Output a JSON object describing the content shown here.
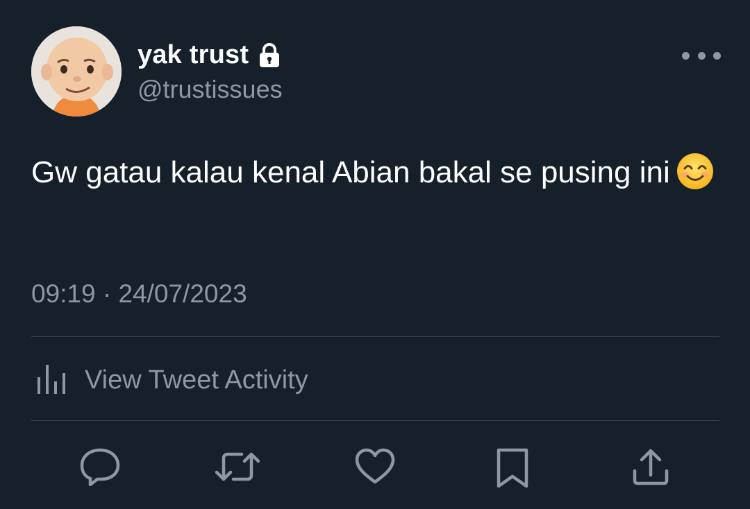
{
  "tweet": {
    "display_name": "yak trust",
    "handle": "@trustissues",
    "text": "Gw gatau kalau kenal Abian bakal se pusing ini",
    "emoji": "smiling-face-with-smiling-eyes",
    "timestamp": "09:19 · 24/07/2023",
    "protected": true
  },
  "activity": {
    "label": "View Tweet Activity",
    "icon": "bar-chart-icon"
  },
  "actions": [
    {
      "name": "reply",
      "icon": "reply-icon"
    },
    {
      "name": "retweet",
      "icon": "retweet-icon"
    },
    {
      "name": "like",
      "icon": "heart-icon"
    },
    {
      "name": "bookmark",
      "icon": "bookmark-icon"
    },
    {
      "name": "share",
      "icon": "share-icon"
    }
  ],
  "colors": {
    "background": "#15202b",
    "primary_text": "#ffffff",
    "secondary_text": "#8b98a5",
    "divider": "#38444d"
  }
}
